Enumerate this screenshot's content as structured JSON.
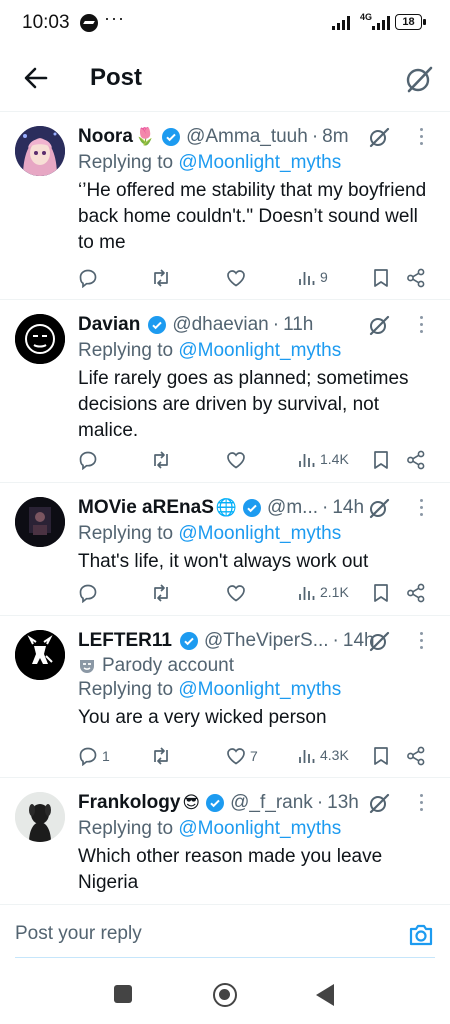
{
  "status": {
    "time": "10:03",
    "network": "4G",
    "battery": "18"
  },
  "header": {
    "title": "Post"
  },
  "tweets": [
    {
      "name": "Noora",
      "emoji": "🌷",
      "handle": "@Amma_tuuh",
      "time": "8m",
      "parody": "",
      "replying_prefix": "Replying to ",
      "replying_to": "@Moonlight_myths",
      "text": "‘’He offered me stability that my boyfriend back home couldn't.\" Doesn’t sound well to me",
      "replies": "",
      "likes": "",
      "views": "9"
    },
    {
      "name": "Davian",
      "emoji": "",
      "handle": "@dhaevian",
      "time": "11h",
      "parody": "",
      "replying_prefix": "Replying to ",
      "replying_to": "@Moonlight_myths",
      "text": "Life rarely goes as planned; sometimes decisions are driven by survival, not malice.",
      "replies": "",
      "likes": "",
      "views": "1.4K"
    },
    {
      "name": "MOVie aREnaS",
      "emoji": "🌐",
      "handle": "@m...",
      "time": "14h",
      "parody": "",
      "replying_prefix": "Replying to ",
      "replying_to": "@Moonlight_myths",
      "text": "That's life, it won't always work out",
      "replies": "",
      "likes": "",
      "views": "2.1K"
    },
    {
      "name": "LEFTER11",
      "emoji": "",
      "handle": "@TheViperS...",
      "time": "14h",
      "parody": "Parody account",
      "replying_prefix": "Replying to ",
      "replying_to": "@Moonlight_myths",
      "text": "You are a very wicked person",
      "replies": "1",
      "likes": "7",
      "views": "4.3K"
    },
    {
      "name": "Frankology",
      "emoji": "😎",
      "handle": "@_f_rank",
      "time": "13h",
      "parody": "",
      "replying_prefix": "Replying to ",
      "replying_to": "@Moonlight_myths",
      "text": "Which other reason made you leave Nigeria",
      "replies": "",
      "likes": "",
      "views": ""
    }
  ],
  "reply_bar": {
    "placeholder": "Post your reply"
  },
  "colors": {
    "accent": "#1d9bf0",
    "text": "#0f1419",
    "secondary": "#536471"
  }
}
